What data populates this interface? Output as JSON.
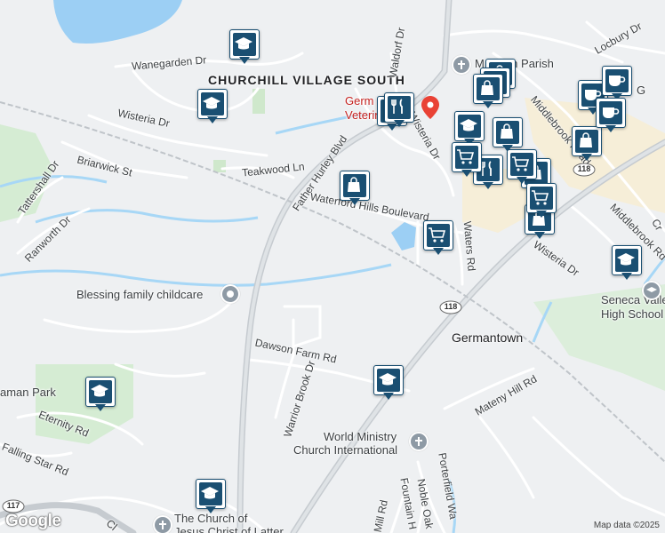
{
  "map": {
    "area_labels": {
      "churchill_village_south": "CHURCHILL VILLAGE SOUTH",
      "germantown": "Germantown"
    },
    "streets": {
      "wanegarden_dr": "Wanegarden Dr",
      "wisteria_dr_nw": "Wisteria Dr",
      "briarwick_st": "Briarwick St",
      "tattershall_dr": "Tattershall Dr",
      "ranworth_dr": "Ranworth Dr",
      "teakwood_ln": "Teakwood Ln",
      "father_hurley_blvd": "Father Hurley Blvd",
      "waterford_hills_blvd": "Waterford Hills Boulevard",
      "waldorf_dr": "Waldorf Dr",
      "wisteria_dr_n": "Wisteria Dr",
      "waters_rd": "Waters Rd",
      "middlebrook_road": "Middlebrook Road",
      "middlebrook_rd": "Middlebrook Rd",
      "wisteria_dr_e": "Wisteria Dr",
      "locbury_dr": "Locbury Dr",
      "dawson_farm_rd": "Dawson Farm Rd",
      "warrior_brook_dr": "Warrior Brook Dr",
      "mateny_hill_rd": "Mateny Hill Rd",
      "eternity_rd": "Eternity Rd",
      "falling_star_rd": "Falling Star Rd",
      "fountain_h": "Fountain H",
      "noble_oak": "Noble Oak",
      "porterfield_wa": "Porterfield Wa",
      "mill_rd": "Mill Rd",
      "cr": "Cr",
      "cl": "Cl"
    },
    "places": {
      "seton_parish": "M    Seton Parish",
      "germantown_vet_1": "Germ",
      "germantown_vet_2": "Veterinar",
      "blessing_childcare": "Blessing family childcare",
      "world_ministry_1": "World Ministry",
      "world_ministry_2": "Church International",
      "church_latter_1": "The Church of",
      "church_latter_2": "Jesus Christ of Latter",
      "seneca_valley_1": "Seneca Valley",
      "seneca_valley_2": "High School",
      "park_partial": "aman Park",
      "partial_g": "G"
    },
    "route_shields": [
      "118",
      "118",
      "117"
    ],
    "markers": [
      {
        "type": "school",
        "icon": "graduation-cap-icon"
      },
      {
        "type": "school",
        "icon": "graduation-cap-icon"
      },
      {
        "type": "school",
        "icon": "graduation-cap-icon"
      },
      {
        "type": "school",
        "icon": "graduation-cap-icon"
      },
      {
        "type": "school",
        "icon": "graduation-cap-icon"
      },
      {
        "type": "school",
        "icon": "graduation-cap-icon"
      },
      {
        "type": "school",
        "icon": "graduation-cap-icon"
      },
      {
        "type": "restaurant",
        "icon": "fork-knife-icon"
      },
      {
        "type": "restaurant",
        "icon": "fork-knife-icon"
      },
      {
        "type": "shopping",
        "icon": "shopping-bag-icon"
      },
      {
        "type": "shopping",
        "icon": "shopping-bag-icon"
      },
      {
        "type": "shopping",
        "icon": "shopping-bag-icon"
      },
      {
        "type": "shopping",
        "icon": "shopping-bag-icon"
      },
      {
        "type": "grocery",
        "icon": "shopping-cart-icon"
      },
      {
        "type": "grocery",
        "icon": "shopping-cart-icon"
      },
      {
        "type": "grocery",
        "icon": "shopping-cart-icon"
      },
      {
        "type": "cafe",
        "icon": "coffee-cup-icon"
      },
      {
        "type": "cafe",
        "icon": "coffee-cup-icon"
      }
    ]
  },
  "attribution": {
    "logo": "Google",
    "credit": "Map data ©2025"
  }
}
